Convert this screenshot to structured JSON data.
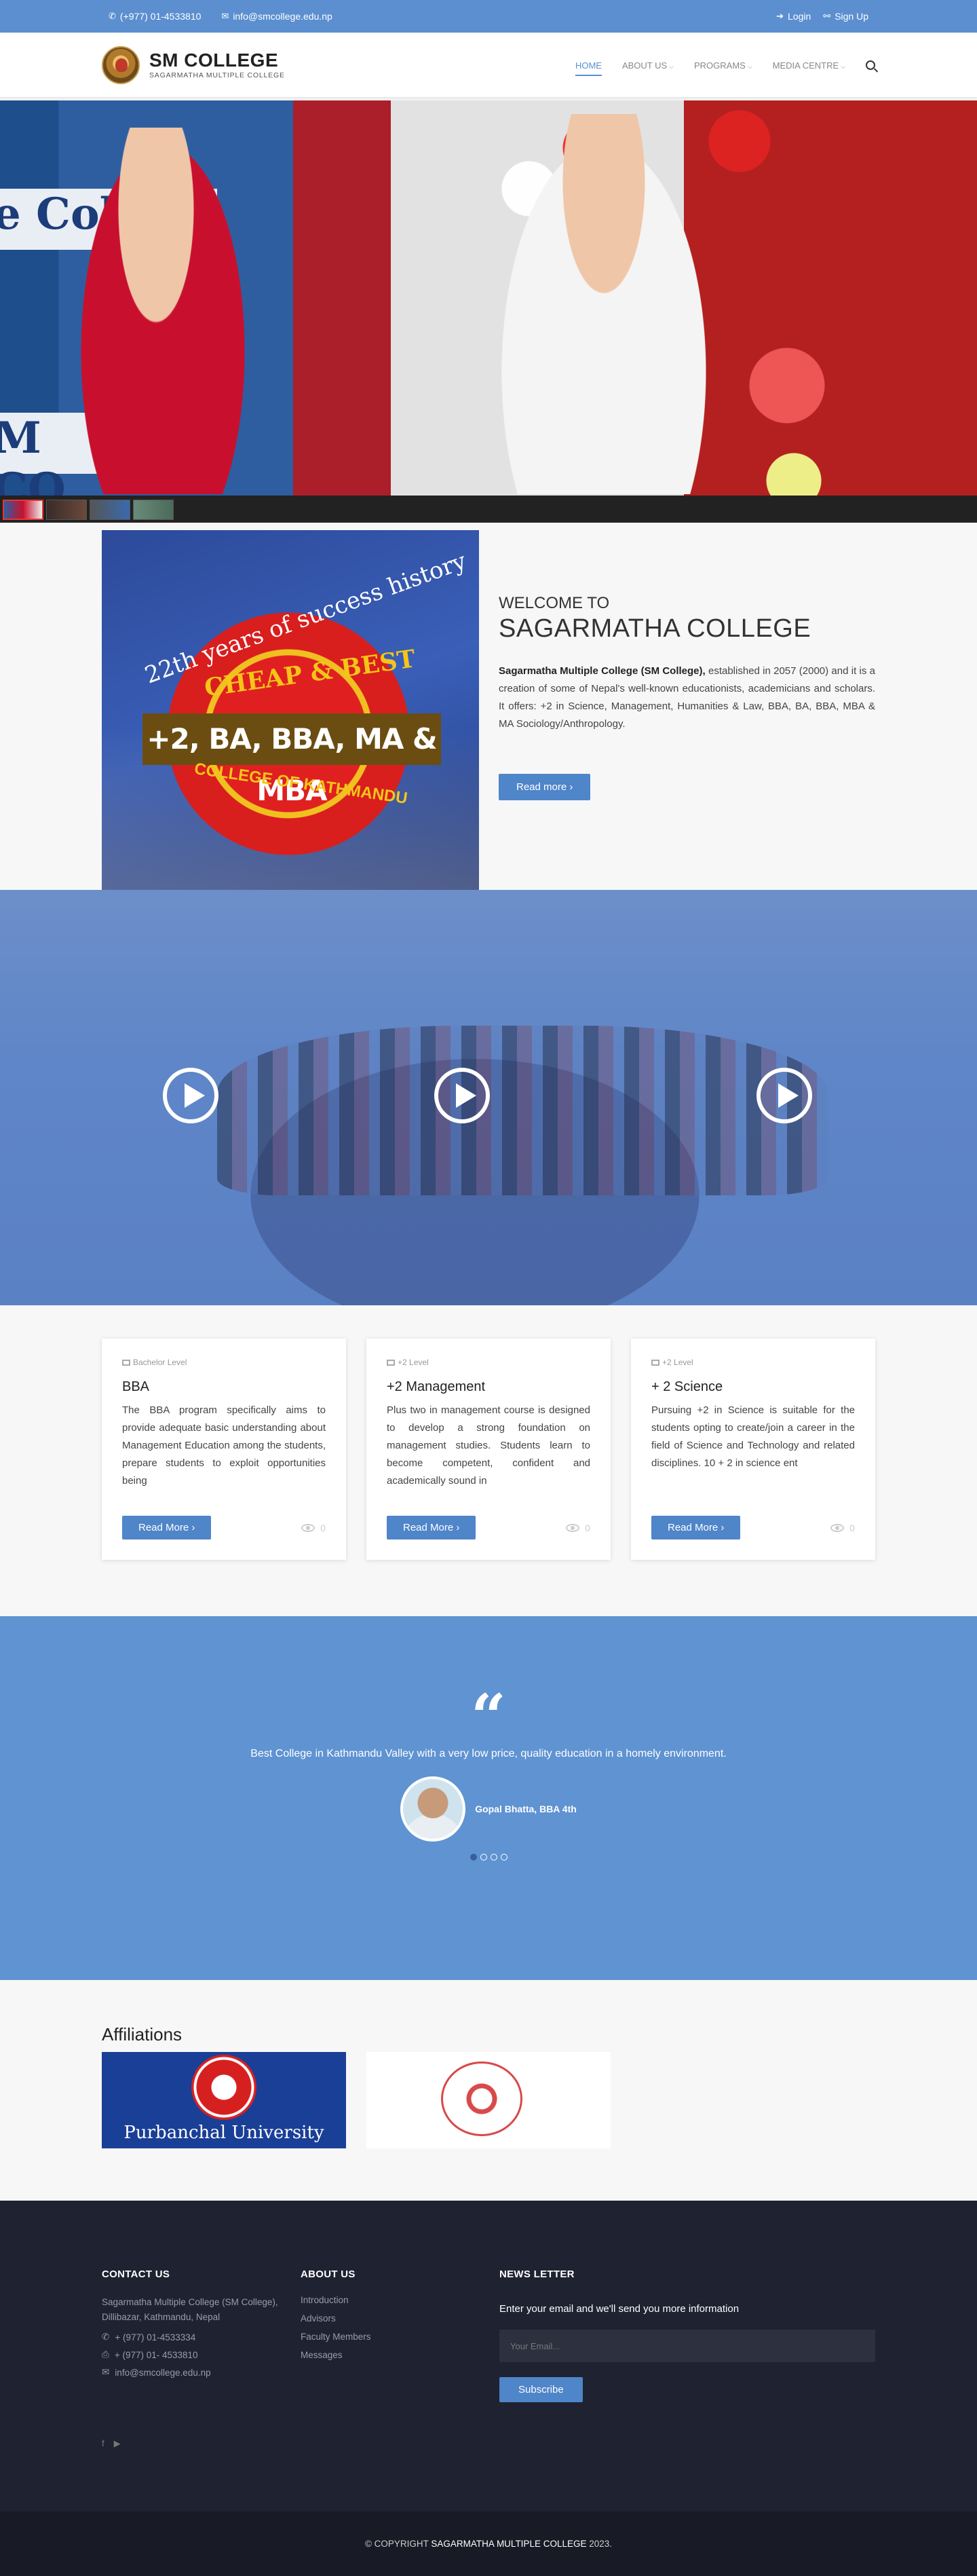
{
  "topbar": {
    "phone": "(+977) 01-4533810",
    "email": "info@smcollege.edu.np",
    "login": "Login",
    "signup": "Sign Up"
  },
  "header": {
    "logo_title": "SM COLLEGE",
    "logo_sub": "SAGARMATHA MULTIPLE COLLEGE",
    "nav": [
      "HOME",
      "ABOUT US",
      "PROGRAMS",
      "MEDIA CENTRE"
    ]
  },
  "hero": {
    "banner_text": "e Colleg",
    "banner_text2": "M CO"
  },
  "welcome": {
    "pre": "WELCOME TO",
    "title": "SAGARMATHA COLLEGE",
    "body_bold": "Sagarmatha Multiple College (SM College),",
    "body": " established in 2057 (2000) and it is a creation of some of Nepal's well-known educationists, academicians and scholars. It offers: +2 in Science, Management, Humanities & Law, BBA, BA, BBA, MBA & MA Sociology/Anthropology.",
    "button": "Read more",
    "poster": {
      "years": "22th years of success history",
      "cheap": "CHEAP & BEST",
      "programs": "+2, BA, BBA, MA & MBA",
      "kathmandu": "COLLEGE OF KATHMANDU"
    }
  },
  "courses": [
    {
      "level": "Bachelor Level",
      "title": "BBA",
      "desc": "The BBA program specifically aims to provide adequate basic understanding about Management Education among the students, prepare students to exploit opportunities being",
      "button": "Read More",
      "views": "0"
    },
    {
      "level": "+2 Level",
      "title": "+2 Management",
      "desc": "Plus two in management course is designed to develop a strong foundation on management studies. Students learn to become competent, confident and academically sound in",
      "button": "Read More",
      "views": "0"
    },
    {
      "level": "+2 Level",
      "title": "+ 2 Science",
      "desc": "Pursuing +2 in Science is suitable for the students opting to create/join a career in the field of Science and Technology and related disciplines. 10 + 2 in science ent",
      "button": "Read More",
      "views": "0"
    }
  ],
  "testimonial": {
    "quote_mark": "“",
    "text": "Best College in Kathmandu Valley with a very low price, quality education in a homely environment.",
    "name": "Gopal Bhatta, BBA 4th"
  },
  "affiliations": {
    "title": "Affiliations",
    "purbanchal": "Purbanchal University"
  },
  "footer": {
    "contact_title": "CONTACT US",
    "address": "Sagarmatha Multiple College (SM College), Dillibazar, Kathmandu, Nepal",
    "phone": "+ (977) 01-4533334",
    "fax": "+ (977) 01- 4533810",
    "email": "info@smcollege.edu.np",
    "about_title": "ABOUT US",
    "about_links": [
      "Introduction",
      "Advisors",
      "Faculty Members",
      "Messages"
    ],
    "news_title": "NEWS LETTER",
    "news_text": "Enter your email and we'll send you more information",
    "email_placeholder": "Your Email...",
    "subscribe": "Subscribe",
    "copyright_pre": "© COPYRIGHT ",
    "copyright_name": "SAGARMATHA MULTIPLE COLLEGE",
    "copyright_year": " 2023."
  }
}
